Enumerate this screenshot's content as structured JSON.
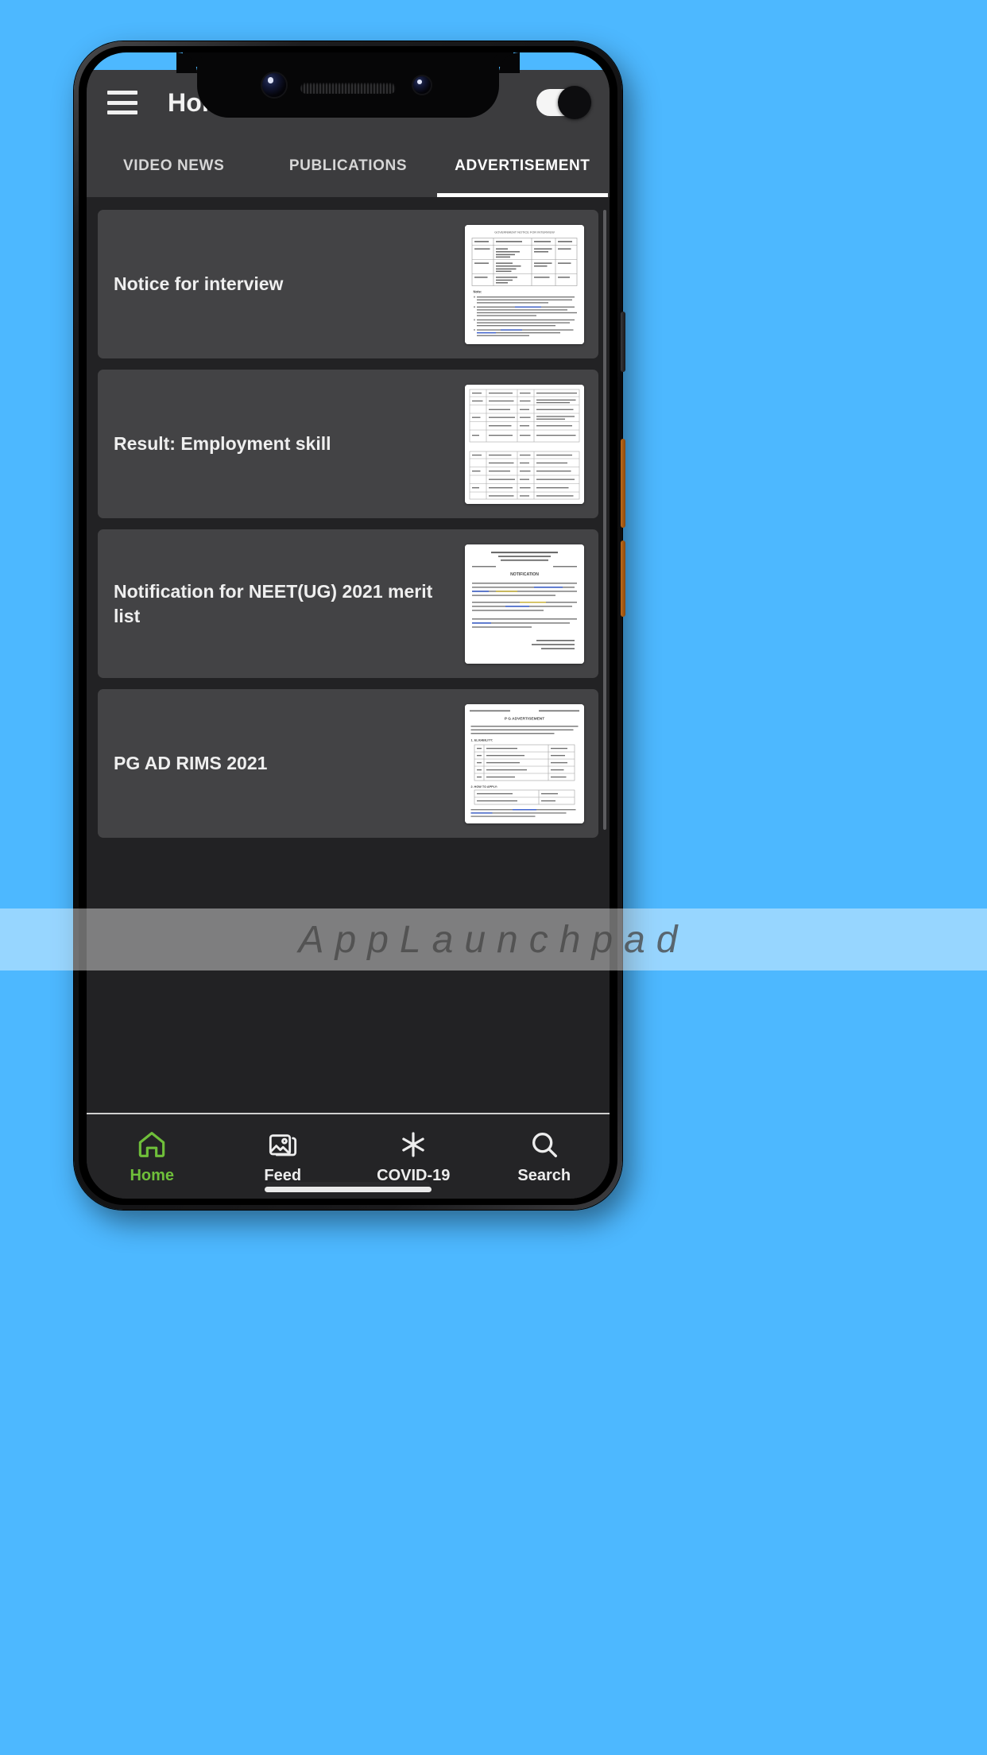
{
  "background_color": "#4db8ff",
  "appbar": {
    "menu_icon": "hamburger-menu-icon",
    "title": "Home",
    "toggle": {
      "name": "theme-toggle",
      "state": "on"
    }
  },
  "tabs": [
    {
      "label": "VIDEO NEWS",
      "active": false
    },
    {
      "label": "PUBLICATIONS",
      "active": false
    },
    {
      "label": "ADVERTISEMENT",
      "active": true
    }
  ],
  "cards": [
    {
      "title": "Notice for interview",
      "thumb": "document-table-thumbnail"
    },
    {
      "title": "Result: Employment skill",
      "thumb": "document-results-table-thumbnail"
    },
    {
      "title": "Notification for NEET(UG) 2021 merit list",
      "thumb": "document-letter-thumbnail"
    },
    {
      "title": "PG AD RIMS 2021",
      "thumb": "document-advertisement-thumbnail"
    }
  ],
  "bottom_nav": [
    {
      "label": "Home",
      "icon": "home-icon",
      "active": true,
      "color": "#6fbf3a"
    },
    {
      "label": "Feed",
      "icon": "images-icon",
      "active": false,
      "color": "#ededed"
    },
    {
      "label": "COVID-19",
      "icon": "medical-asterisk-icon",
      "active": false,
      "color": "#ededed"
    },
    {
      "label": "Search",
      "icon": "search-icon",
      "active": false,
      "color": "#ededed"
    }
  ],
  "watermark": {
    "text": "AppLaunchpad"
  }
}
